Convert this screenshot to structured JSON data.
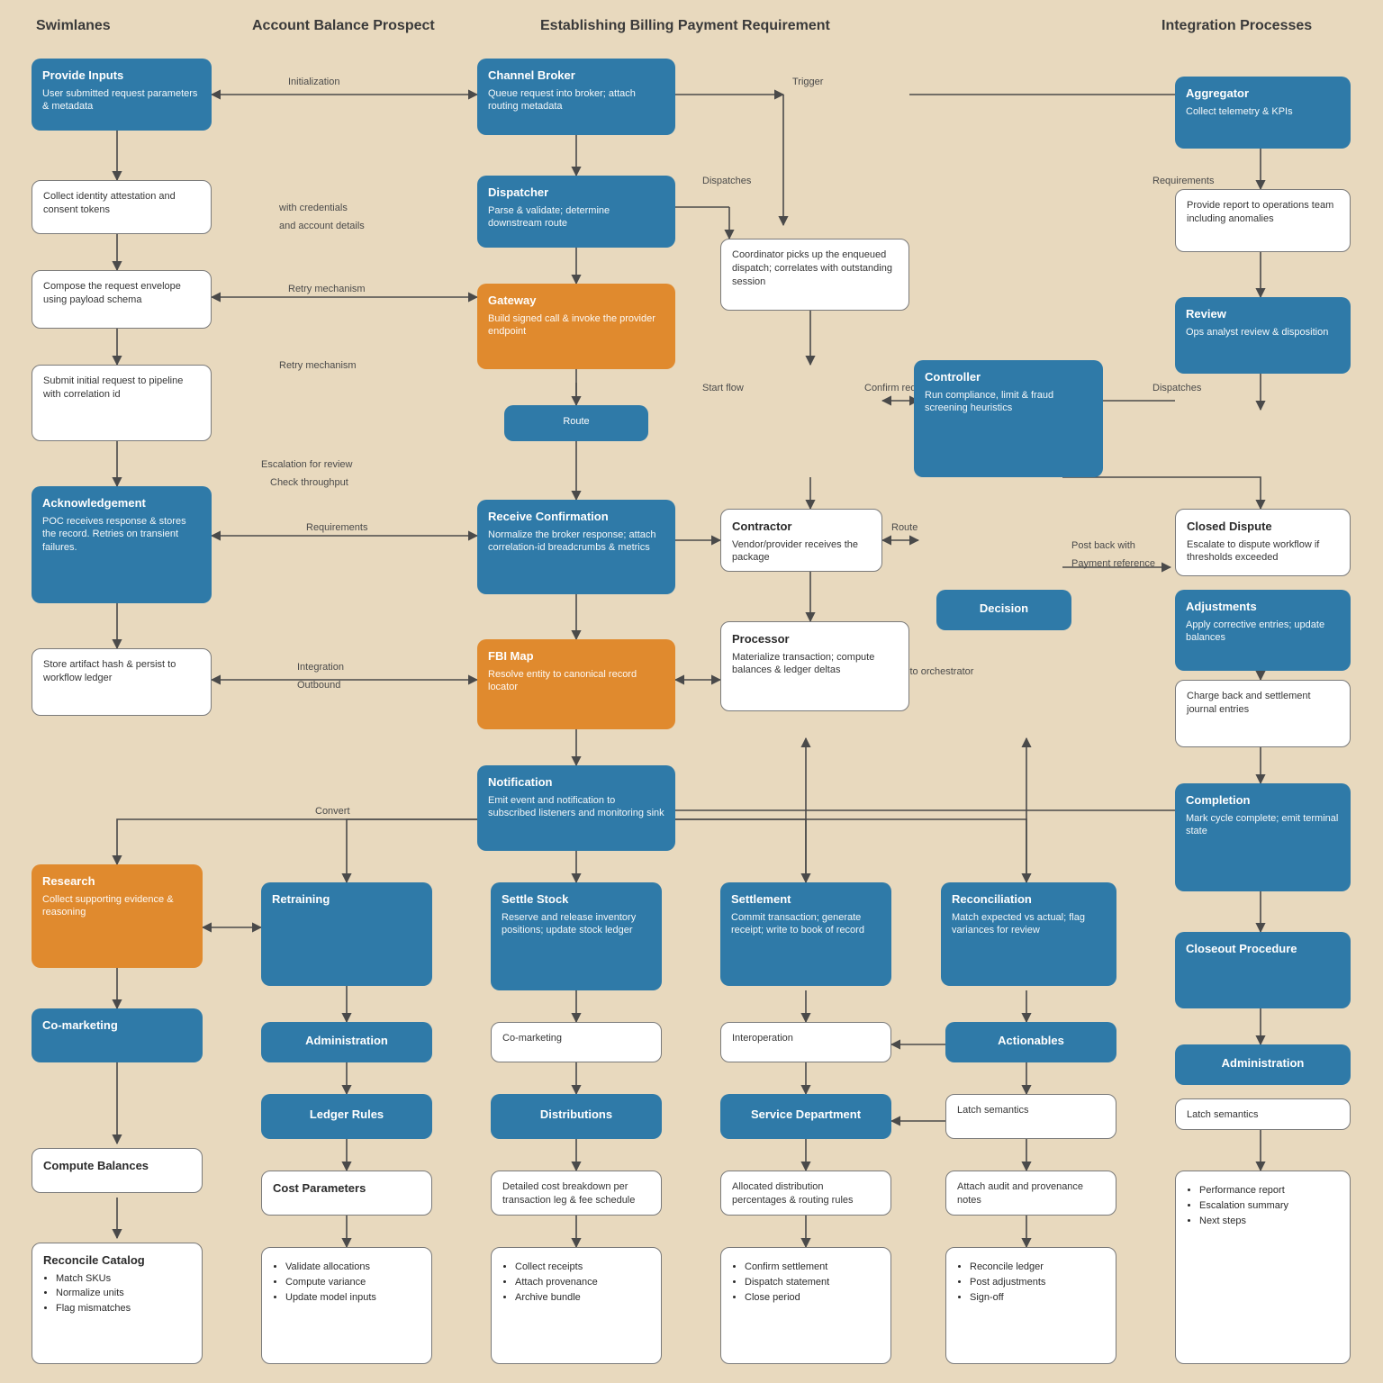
{
  "colors": {
    "blue": "#2f7aa8",
    "orange": "#e08a2e",
    "stroke": "#4a4a4a",
    "bg": "#e8d9be"
  },
  "headings": {
    "h1": "Swimlanes",
    "h2": "Account Balance Prospect",
    "h3": "Establishing Billing Payment Requirement",
    "h4": "Integration Processes"
  },
  "edgeLabels": {
    "e1": "Initialization",
    "e2": "Trigger",
    "e3": "Dispatches",
    "e4": "Requirements",
    "e5": "with credentials",
    "e6": "and account details",
    "e7": "Retry mechanism",
    "e8": "Start flow",
    "e9": "Confirm request",
    "e10": "Escalation for review",
    "e11": "Check throughput",
    "e12": "Route",
    "e13": "Post back with",
    "e14": "Payment reference",
    "e15": "Integration",
    "e16": "Outbound",
    "e17": "Convert",
    "e18": "Synchronize state to orchestrator"
  },
  "nodes": {
    "n_a1": {
      "title": "Provide Inputs",
      "body": "User submitted request parameters & metadata"
    },
    "n_a2": {
      "title": "",
      "body": "Collect identity attestation and consent tokens"
    },
    "n_a3": {
      "title": "",
      "body": "Compose the request envelope using payload schema"
    },
    "n_a4": {
      "title": "",
      "body": "Submit initial request to pipeline with correlation id"
    },
    "n_a5": {
      "title": "Acknowledgement",
      "body": "POC receives response & stores the record. Retries on transient failures."
    },
    "n_a6": {
      "title": "",
      "body": "Store artifact hash & persist to workflow ledger"
    },
    "n_b1": {
      "title": "Channel Broker",
      "body": "Queue request into broker; attach routing metadata"
    },
    "n_b2": {
      "title": "Dispatcher",
      "body": "Parse & validate; determine downstream route"
    },
    "n_b3": {
      "title": "Gateway",
      "body": "Build signed call & invoke the provider endpoint"
    },
    "n_b4": {
      "title": "Receive Confirmation",
      "body": "Normalize the broker response; attach correlation-id breadcrumbs & metrics"
    },
    "n_b5": {
      "title": "FBI Map",
      "body": "Resolve entity to canonical record locator"
    },
    "n_b6": {
      "title": "Notification",
      "body": "Emit event and notification to subscribed listeners and monitoring sink"
    },
    "n_c1": {
      "title": "",
      "body": "Coordinator picks up the enqueued dispatch; correlates with outstanding session"
    },
    "n_c2": {
      "title": "Contractor",
      "body": "Vendor/provider receives the package"
    },
    "n_c3": {
      "title": "Processor",
      "body": "Materialize transaction; compute balances & ledger deltas"
    },
    "n_c4": {
      "title": "Controller",
      "body": "Run compliance, limit & fraud screening heuristics"
    },
    "n_c5": {
      "title": "Decision",
      "body": ""
    },
    "n_c6": {
      "title": "Settlement",
      "body": "Commit transaction; generate receipt; write to book of record"
    },
    "n_c7": {
      "title": "Reconciliation",
      "body": "Match expected vs actual; flag variances for review"
    },
    "n_d1": {
      "title": "Aggregator",
      "body": "Collect telemetry & KPIs"
    },
    "n_d2": {
      "title": "",
      "body": "Provide report to operations team including anomalies"
    },
    "n_d3": {
      "title": "Review",
      "body": "Ops analyst review & disposition"
    },
    "n_d4": {
      "title": "Closed Dispute",
      "body": "Escalate to dispute workflow if thresholds exceeded"
    },
    "n_d5": {
      "title": "Adjustments",
      "body": "Apply corrective entries; update balances"
    },
    "n_d6": {
      "title": "",
      "body": "Charge back and settlement journal entries"
    },
    "n_d7": {
      "title": "Completion",
      "body": "Mark cycle complete; emit terminal state"
    },
    "n_d8": {
      "title": "Closeout Procedure",
      "body": ""
    },
    "n_d9": {
      "title": "Administration",
      "body": ""
    },
    "n_e1": {
      "title": "Research",
      "body": "Collect supporting evidence & reasoning"
    },
    "n_e2": {
      "title": "Co-marketing",
      "body": ""
    },
    "n_e3": {
      "title": "Retraining",
      "body": ""
    },
    "n_e4": {
      "title": "Administration",
      "body": ""
    },
    "n_e5": {
      "title": "Ledger Rules",
      "body": ""
    },
    "n_e6": {
      "title": "Settle Stock",
      "body": "Reserve and release inventory positions; update stock ledger"
    },
    "n_e7": {
      "title": "Interoperation",
      "body": ""
    },
    "n_e8": {
      "title": "Service Department",
      "body": ""
    },
    "n_e9": {
      "title": "Actionables",
      "body": ""
    },
    "n_f1": {
      "title": "Compute Balances",
      "body": ""
    },
    "n_f2": {
      "title": "Cost Parameters",
      "body": ""
    },
    "n_f3": {
      "title": "",
      "body": "Detailed cost breakdown per transaction leg & fee schedule"
    },
    "n_f4": {
      "title": "Distributions",
      "body": ""
    },
    "n_f5": {
      "title": "",
      "body": "Allocated distribution percentages & routing rules"
    },
    "n_f6": {
      "title": "Latch semantics",
      "body": ""
    },
    "n_f7": {
      "title": "",
      "body": "Attach audit and provenance notes"
    },
    "list_a": {
      "title": "Reconcile Catalog",
      "items": [
        "Match SKUs",
        "Normalize units",
        "Flag mismatches"
      ]
    },
    "list_b": {
      "title": "",
      "items": [
        "Validate allocations",
        "Compute variance",
        "Update model inputs"
      ]
    },
    "list_c": {
      "title": "",
      "items": [
        "Collect receipts",
        "Attach provenance",
        "Archive bundle"
      ]
    },
    "list_d": {
      "title": "",
      "items": [
        "Confirm settlement",
        "Dispatch statement",
        "Close period"
      ]
    },
    "list_e": {
      "title": "",
      "items": [
        "Reconcile ledger",
        "Post adjustments",
        "Sign-off"
      ]
    },
    "list_f": {
      "title": "",
      "items": [
        "Performance report",
        "Escalation summary",
        "Next steps"
      ]
    }
  }
}
